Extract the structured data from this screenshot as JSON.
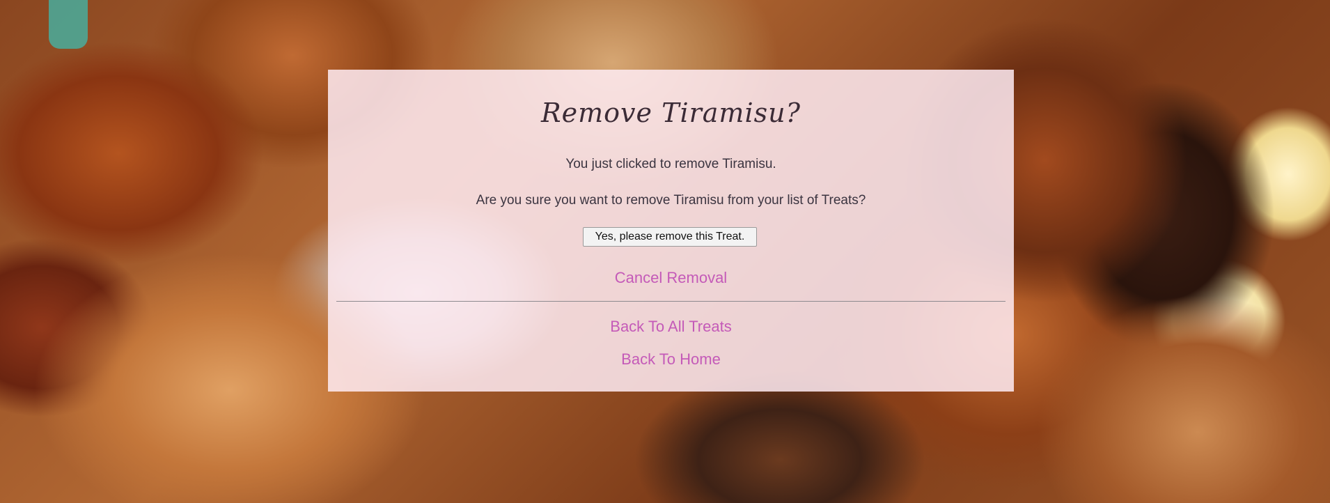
{
  "background": {
    "description_icon": "pastry-photo-background"
  },
  "dialog": {
    "title": "Remove Tiramisu?",
    "message_1": "You just clicked to remove Tiramisu.",
    "message_2": "Are you sure you want to remove Tiramisu from your list of Treats?",
    "confirm_button_label": "Yes, please remove this Treat.",
    "cancel_link": "Cancel Removal",
    "back_treats_link": "Back To All Treats",
    "back_home_link": "Back To Home"
  },
  "colors": {
    "panel_background": "#ffecf4",
    "link": "#c45ab8",
    "text": "#3b3440"
  }
}
